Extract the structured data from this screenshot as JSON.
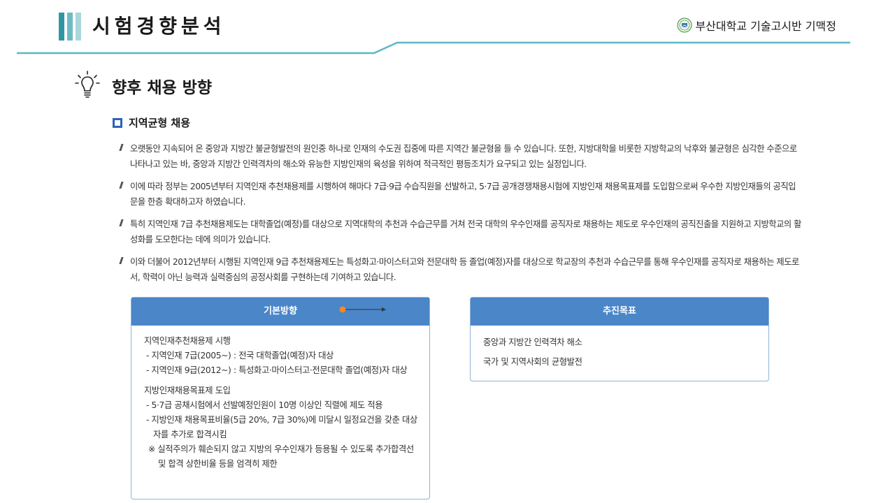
{
  "header": {
    "title": "시험경향분석",
    "org": "부산대학교 기술고시반 기맥정",
    "accent": "#5ab8c4"
  },
  "section": {
    "title": "향후 채용 방향",
    "icon": "lightbulb-icon"
  },
  "subsection": {
    "title": "지역균형 채용"
  },
  "paragraphs": [
    "오랫동안 지속되어 온 중앙과 지방간 불균형발전의 원인중 하나로 인재의 수도권 집중에 따른 지역간 불균형을 들 수 있습니다. 또한, 지방대학을 비롯한 지방학교의 낙후와 불균형은 심각한 수준으로 나타나고 있는 바, 중앙과 지방간 인력격차의 해소와 유능한 지방인재의 육성을 위하여 적극적인 평등조치가 요구되고 있는 실정입니다.",
    "이에 따라 정부는 2005년부터 지역인재 추천채용제를 시행하여 해마다 7급·9급 수습직원을 선발하고, 5·7급 공개경쟁채용시험에 지방인재 채용목표제를 도입함으로써 우수한 지방인재들의 공직입문을 한층 확대하고자 하였습니다.",
    "특히 지역인재 7급 추천채용제도는 대학졸업(예정)를 대상으로 지역대학의 추천과 수습근무를 거쳐 전국 대학의 우수인재를 공직자로 채용하는 제도로 우수인재의 공직진출을 지원하고 지방학교의 활성화를 도모한다는 데에 의미가 있습니다.",
    "이와 더불어 2012년부터 시행된 지역인재 9급 추천채용제도는 특성화고·마이스터고와 전문대학 등 졸업(예정)자를 대상으로 학교장의 추천과 수습근무를 통해 우수인재를 공직자로 채용하는 제도로서, 학력이 아닌 능력과 실력중심의 공정사회를 구현하는데 기여하고 있습니다."
  ],
  "basic_box": {
    "title": "기본방향",
    "groups": [
      {
        "title": "지역인재추천채용제 시행",
        "items": [
          "- 지역인재 7급(2005~) : 전국 대학졸업(예정)자 대상",
          "- 지역인재 9급(2012~) : 특성화고·마이스터고·전문대학 졸업(예정)자 대상"
        ]
      },
      {
        "title": "지방인재채용목표제 도입",
        "items": [
          "- 5·7급 공채시험에서 선발예정인원이 10명 이상인 직렬에 제도 적용",
          "- 지방인재 채용목표비율(5급 20%, 7급 30%)에 미달시 일정요건을 갖춘 대상자를 추가로 합격시킴"
        ],
        "note": "※ 실적주의가 훼손되지 않고 지방의 우수인재가 등용될 수 있도록 추가합격선 및 합격 상한비율 등을 엄격히 제한"
      }
    ]
  },
  "target_box": {
    "title": "추진목표",
    "items": [
      "중앙과 지방간 인력격차 해소",
      "국가 및 지역사회의 균형발전"
    ]
  },
  "colors": {
    "box_header": "#4a86c8",
    "connector_dot": "#f08a24"
  }
}
